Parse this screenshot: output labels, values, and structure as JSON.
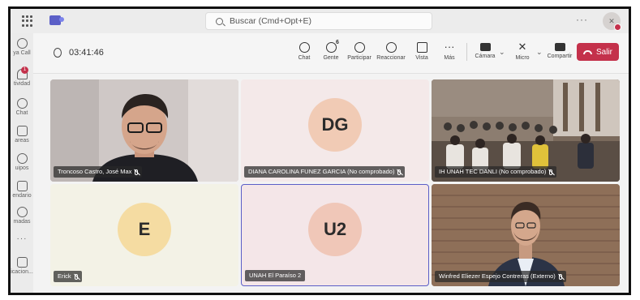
{
  "topbar": {
    "search_placeholder": "Buscar (Cmd+Opt+E)",
    "more_label": "···"
  },
  "rail": {
    "items": [
      {
        "label": "ya Call",
        "icon": "calls-icon"
      },
      {
        "label": "tividad",
        "icon": "bell-icon",
        "badge": "1"
      },
      {
        "label": "Chat",
        "icon": "chat-icon"
      },
      {
        "label": "areas",
        "icon": "tasks-icon"
      },
      {
        "label": "uipos",
        "icon": "teams-icon"
      },
      {
        "label": "endario",
        "icon": "calendar-icon"
      },
      {
        "label": "madas",
        "icon": "phone-icon"
      },
      {
        "label": "···",
        "icon": "more-icon"
      },
      {
        "label": "icacion...",
        "icon": "apps-icon"
      }
    ]
  },
  "meeting": {
    "timer": "03:41:46",
    "controls": [
      {
        "label": "Chat",
        "icon": "chat-icon"
      },
      {
        "label": "Gente",
        "icon": "people-icon",
        "count": "6"
      },
      {
        "label": "Participar",
        "icon": "raise-hand-icon"
      },
      {
        "label": "Reaccionar",
        "icon": "emoji-icon"
      },
      {
        "label": "Vista",
        "icon": "view-icon"
      },
      {
        "label": "Más",
        "icon": "more-icon"
      }
    ],
    "camera_label": "Cámara",
    "mic_label": "Micro",
    "share_label": "Compartir",
    "leave_label": "Salir",
    "leave_color": "#c4314b"
  },
  "participants": [
    {
      "name": "Troncoso Castro, José Max",
      "type": "video"
    },
    {
      "name": "DIANA CAROLINA FUNEZ GARCIA (No comprobado)",
      "initials": "DG",
      "avatar_color": "#f1cbb5",
      "type": "avatar"
    },
    {
      "name": "IH UNAH TEC DANLI (No comprobado)",
      "type": "video"
    },
    {
      "name": "Erick",
      "initials": "E",
      "avatar_color": "#f5dca2",
      "type": "avatar"
    },
    {
      "name": "UNAH El Paraíso 2",
      "initials": "U2",
      "avatar_color": "#f0c7b8",
      "type": "avatar",
      "selected": true
    },
    {
      "name": "Winfred Eliezer Espejo Contreras (Externo)",
      "type": "video"
    }
  ]
}
